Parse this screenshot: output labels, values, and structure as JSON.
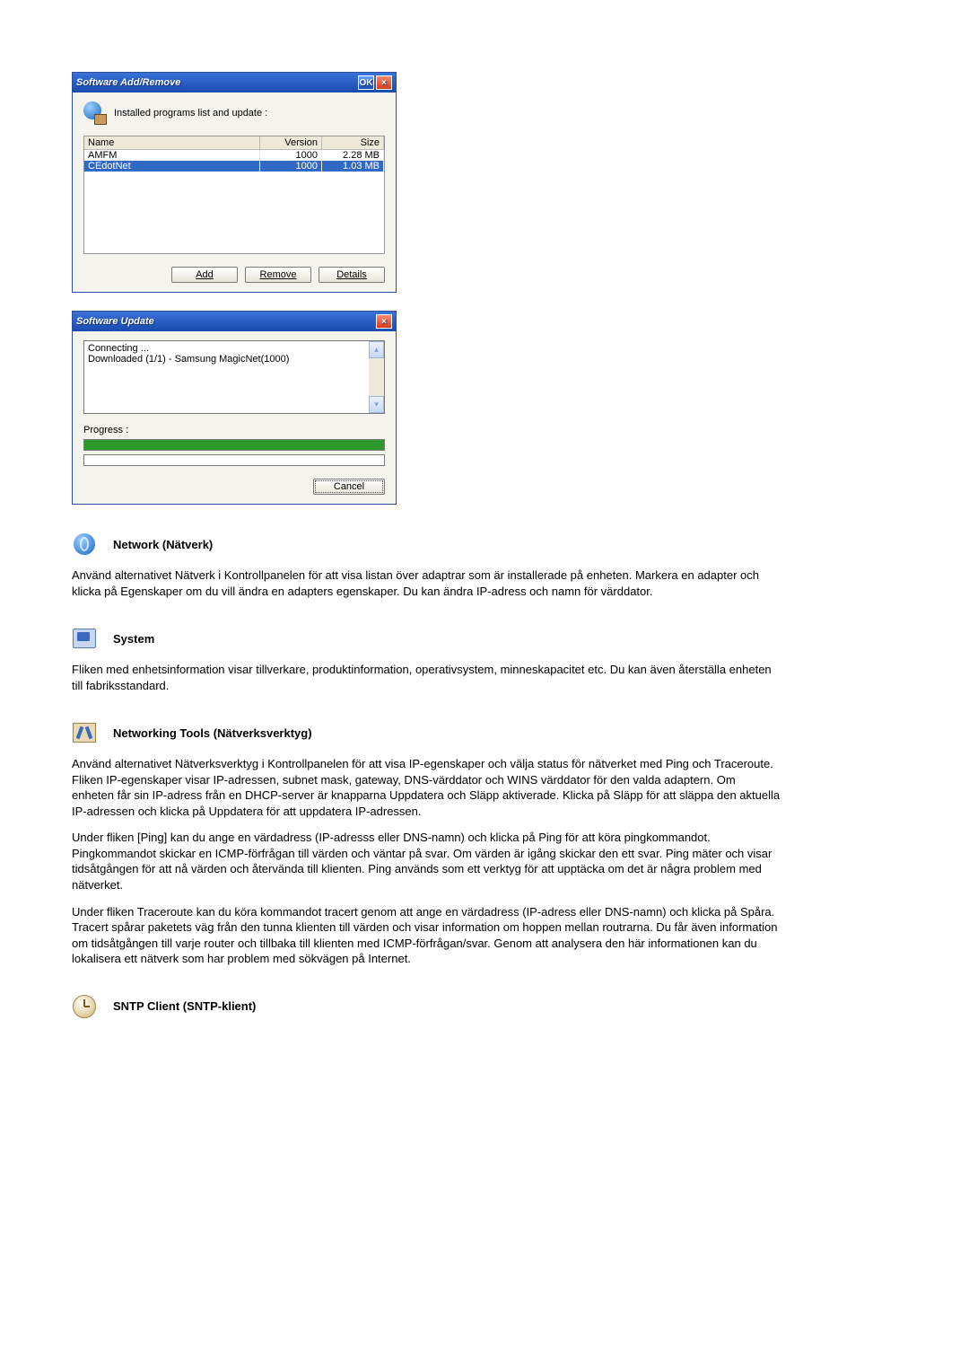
{
  "dialog_addremove": {
    "title": "Software Add/Remove",
    "ok": "OK",
    "close_glyph": "×",
    "list_label": "Installed programs list and update :",
    "headers": {
      "name": "Name",
      "version": "Version",
      "size": "Size"
    },
    "rows": [
      {
        "name": "AMFM",
        "version": "1000",
        "size": "2.28 MB",
        "selected": false
      },
      {
        "name": "CEdotNet",
        "version": "1000",
        "size": "1.03 MB",
        "selected": true
      }
    ],
    "buttons": {
      "add": "Add",
      "remove": "Remove",
      "details": "Details"
    }
  },
  "dialog_update": {
    "title": "Software Update",
    "close_glyph": "×",
    "log": {
      "line1": "Connecting ...",
      "line2": "Downloaded (1/1) - Samsung MagicNet(1000)"
    },
    "scroll_up": "▴",
    "scroll_down": "▾",
    "progress_label": "Progress :",
    "cancel": "Cancel"
  },
  "sections": {
    "network": {
      "title": "Network (Nätverk)",
      "p1": "Använd alternativet Nätverk i Kontrollpanelen för att visa listan över adaptrar som är installerade på enheten. Markera en adapter och klicka på Egenskaper om du vill ändra en adapters egenskaper. Du kan ändra IP-adress och namn för värddator."
    },
    "system": {
      "title": "System",
      "p1": "Fliken med enhetsinformation visar tillverkare, produktinformation, operativsystem, minneskapacitet etc. Du kan även återställa enheten till fabriksstandard."
    },
    "nettools": {
      "title": "Networking Tools (Nätverksverktyg)",
      "p1": "Använd alternativet Nätverksverktyg i Kontrollpanelen för att visa IP-egenskaper och välja status för nätverket med Ping och Traceroute. Fliken IP-egenskaper visar IP-adressen, subnet mask, gateway, DNS-värddator och WINS värddator för den valda adaptern. Om enheten får sin IP-adress från en DHCP-server är knapparna Uppdatera och Släpp aktiverade. Klicka på Släpp för att släppa den aktuella IP-adressen och klicka på Uppdatera för att uppdatera IP-adressen.",
      "p2": "Under fliken [Ping] kan du ange en värdadress (IP-adresss eller DNS-namn) och klicka på Ping för att köra pingkommandot. Pingkommandot skickar en ICMP-förfrågan till värden och väntar på svar. Om värden är igång skickar den ett svar. Ping mäter och visar tidsåtgången för att nå värden och återvända till klienten. Ping används som ett verktyg för att upptäcka om det är några problem med nätverket.",
      "p3": "Under fliken Traceroute kan du köra kommandot tracert genom att ange en värdadress (IP-adress eller DNS-namn) och klicka på Spåra. Tracert spårar paketets väg från den tunna klienten till värden och visar information om hoppen mellan routrarna. Du får även information om tidsåtgången till varje router och tillbaka till klienten med ICMP-förfrågan/svar. Genom att analysera den här informationen kan du lokalisera ett nätverk som har problem med sökvägen på Internet."
    },
    "sntp": {
      "title": "SNTP Client (SNTP-klient)"
    }
  }
}
